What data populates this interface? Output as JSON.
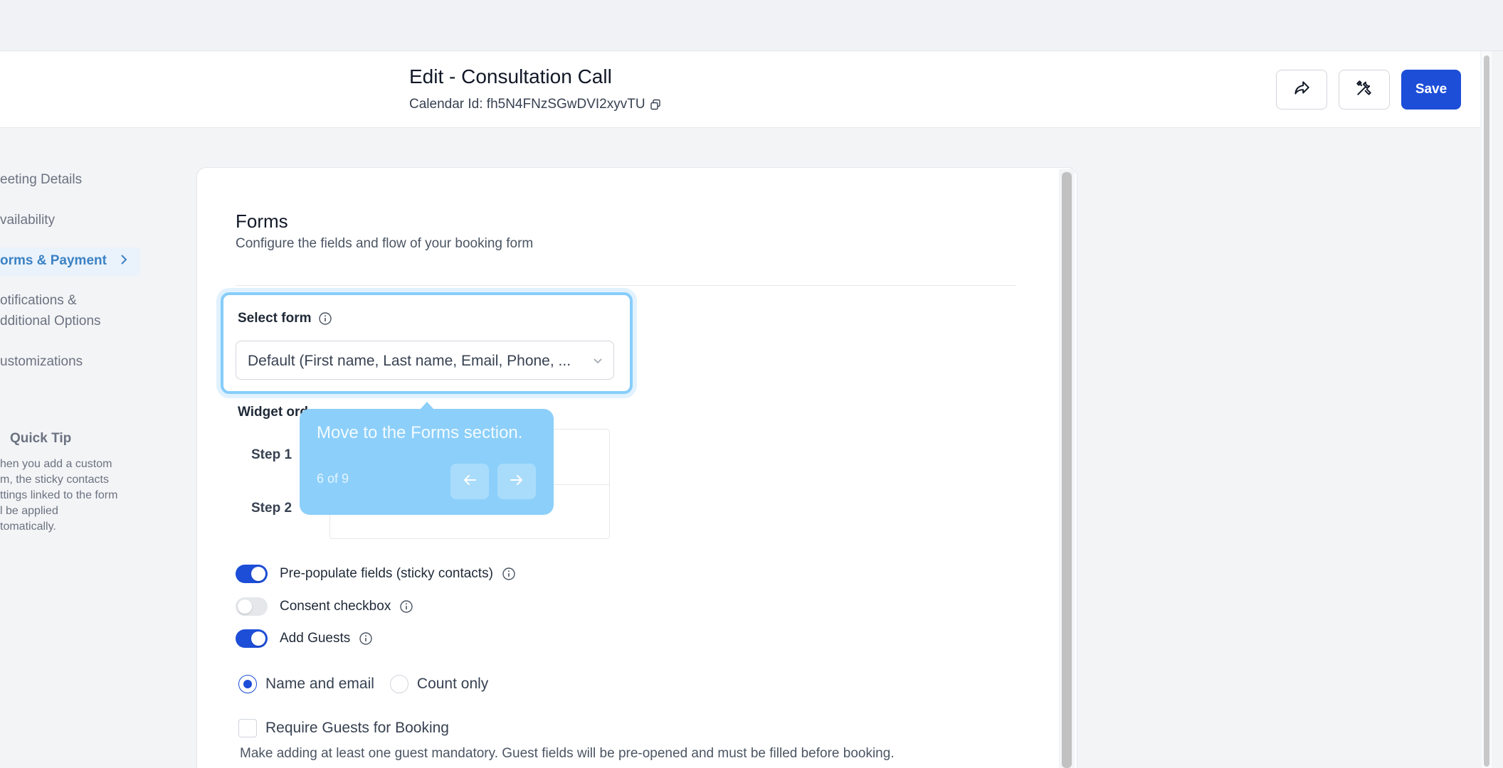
{
  "header": {
    "title": "Edit - Consultation Call",
    "calendar_id_label": "Calendar Id: fh5N4FNzSGwDVI2xyvTU",
    "save_label": "Save"
  },
  "sidebar": {
    "items": [
      {
        "label": "eeting Details"
      },
      {
        "label": "vailability"
      },
      {
        "label": "orms & Payment"
      },
      {
        "label": "otifications &"
      },
      {
        "label": "dditional Options"
      },
      {
        "label": "ustomizations"
      }
    ],
    "quick_tip_title": "Quick Tip",
    "quick_tip_lines": [
      "hen you add a custom",
      "m, the sticky contacts",
      "ttings linked to the form",
      "l be applied",
      "tomatically."
    ]
  },
  "forms": {
    "title": "Forms",
    "subtitle": "Configure the fields and flow of your booking form",
    "select_form_label": "Select form",
    "select_form_value": "Default (First name, Last name, Email, Phone, ...",
    "widget_order_label": "Widget ord",
    "step1_label": "Step 1",
    "step2_label": "Step 2",
    "toggles": [
      {
        "label": "Pre-populate fields (sticky contacts)",
        "on": true
      },
      {
        "label": "Consent checkbox",
        "on": false
      },
      {
        "label": "Add Guests",
        "on": true
      }
    ],
    "radio_name_email": "Name and email",
    "radio_count_only": "Count only",
    "require_guests_label": "Require Guests for Booking",
    "require_guests_help": "Make adding at least one guest mandatory. Guest fields will be pre-opened and must be filled before booking."
  },
  "tooltip": {
    "text": "Move to the Forms section.",
    "count": "6 of 9"
  },
  "colors": {
    "primary": "#1d4ed8",
    "tooltip_bg": "#8ccffa",
    "sidebar_active": "#3b82c4"
  }
}
